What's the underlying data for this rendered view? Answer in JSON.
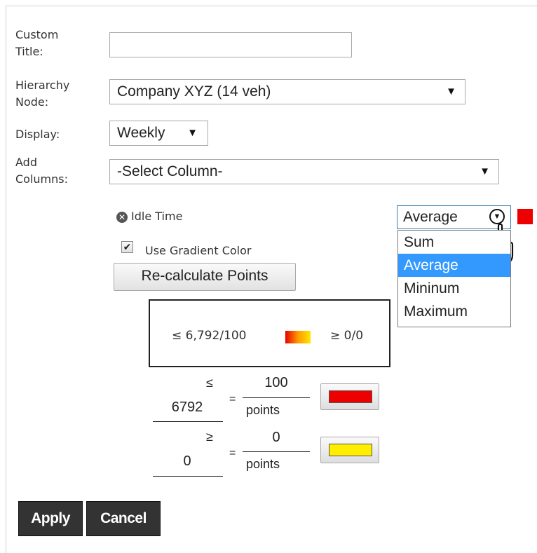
{
  "form": {
    "custom_title_label": "Custom\nTitle:",
    "custom_title_value": "",
    "hierarchy_label": "Hierarchy\nNode:",
    "hierarchy_value": "Company XYZ (14 veh)",
    "display_label": "Display:",
    "display_value": "Weekly",
    "add_columns_label": "Add\nColumns:",
    "add_columns_value": "-Select Column-"
  },
  "column": {
    "name": "Idle Time",
    "aggregate_value": "Average",
    "color": "#ee0000",
    "gradient_label": "Use Gradient Color",
    "gradient_checked": true,
    "recalc_label": "Re-calculate Points"
  },
  "dropdown": {
    "options": [
      "Sum",
      "Average",
      "Mininum",
      "Maximum"
    ],
    "selected": "Average"
  },
  "legend": {
    "low_text": "≤ 6,792/100",
    "high_text": "≥ 0/0"
  },
  "thresholds": [
    {
      "op": "≤",
      "value": "6792",
      "equals": "=",
      "points": "100",
      "points_label": "points",
      "color": "#ee0000"
    },
    {
      "op": "≥",
      "value": "0",
      "equals": "=",
      "points": "0",
      "points_label": "points",
      "color": "#ffee00"
    }
  ],
  "actions": {
    "apply_label": "Apply",
    "cancel_label": "Cancel"
  }
}
